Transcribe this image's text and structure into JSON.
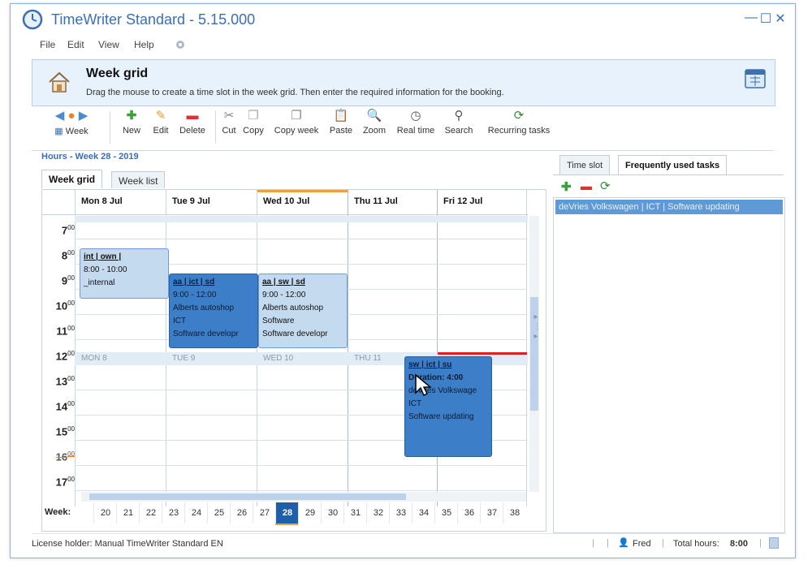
{
  "window": {
    "title": "TimeWriter Standard - 5.15.000",
    "controls": {
      "minimize": "—",
      "maximize": "☐",
      "close": "✕"
    }
  },
  "menu": {
    "file": "File",
    "edit": "Edit",
    "view": "View",
    "help": "Help"
  },
  "banner": {
    "title": "Week grid",
    "description": "Drag the mouse to create a time slot in the week grid. Then enter the required information for the booking."
  },
  "toolbar": {
    "week": "Week",
    "new": "New",
    "edit": "Edit",
    "delete": "Delete",
    "cut": "Cut",
    "copy": "Copy",
    "copy_week": "Copy week",
    "paste": "Paste",
    "zoom": "Zoom",
    "real_time": "Real time",
    "search": "Search",
    "recurring_tasks": "Recurring tasks"
  },
  "hours_title": "Hours - Week 28 - 2019",
  "tabs": {
    "week_grid": "Week grid",
    "week_list": "Week list"
  },
  "days": [
    "Mon 8 Jul",
    "Tue 9 Jul",
    "Wed 10 Jul",
    "Thu 11 Jul",
    "Fri 12 Jul"
  ],
  "hours": [
    "7",
    "8",
    "9",
    "10",
    "11",
    "12",
    "13",
    "14",
    "15",
    "16",
    "17"
  ],
  "hour_suffix": "00",
  "mid_labels": [
    "MON 8",
    "TUE 9",
    "WED 10",
    "THU 11"
  ],
  "events": [
    {
      "title": "int | own |",
      "lines": [
        "8:00 - 10:00",
        "_internal"
      ]
    },
    {
      "title": "aa | ict | sd",
      "lines": [
        "9:00 - 12:00",
        "Alberts autoshop",
        "ICT",
        "Software developr"
      ]
    },
    {
      "title": "aa | sw | sd",
      "lines": [
        "9:00 - 12:00",
        "Alberts autoshop",
        "Software",
        "Software developr"
      ]
    },
    {
      "title": "sw | ict | su",
      "lines": [
        "Duration: 4:00",
        "deVries Volkswage",
        "ICT",
        "Software updating"
      ]
    }
  ],
  "week_label": "Week:",
  "weeks": [
    "20",
    "21",
    "22",
    "23",
    "24",
    "25",
    "26",
    "27",
    "28",
    "29",
    "30",
    "31",
    "32",
    "33",
    "34",
    "35",
    "36",
    "37",
    "38"
  ],
  "current_week": "28",
  "right_tabs": {
    "time_slot": "Time slot",
    "frequent": "Frequently used tasks"
  },
  "frequent_task": "deVries Volkswagen | ICT | Software updating",
  "status": {
    "license": "License holder: Manual TimeWriter Standard EN",
    "user": "Fred",
    "total_label": "Total hours:",
    "total_value": "8:00"
  },
  "colors": {
    "accent": "#3a6fb5",
    "event_dark": "#3c7ec8",
    "event_light": "#c4daef",
    "current_time": "#e02020"
  }
}
